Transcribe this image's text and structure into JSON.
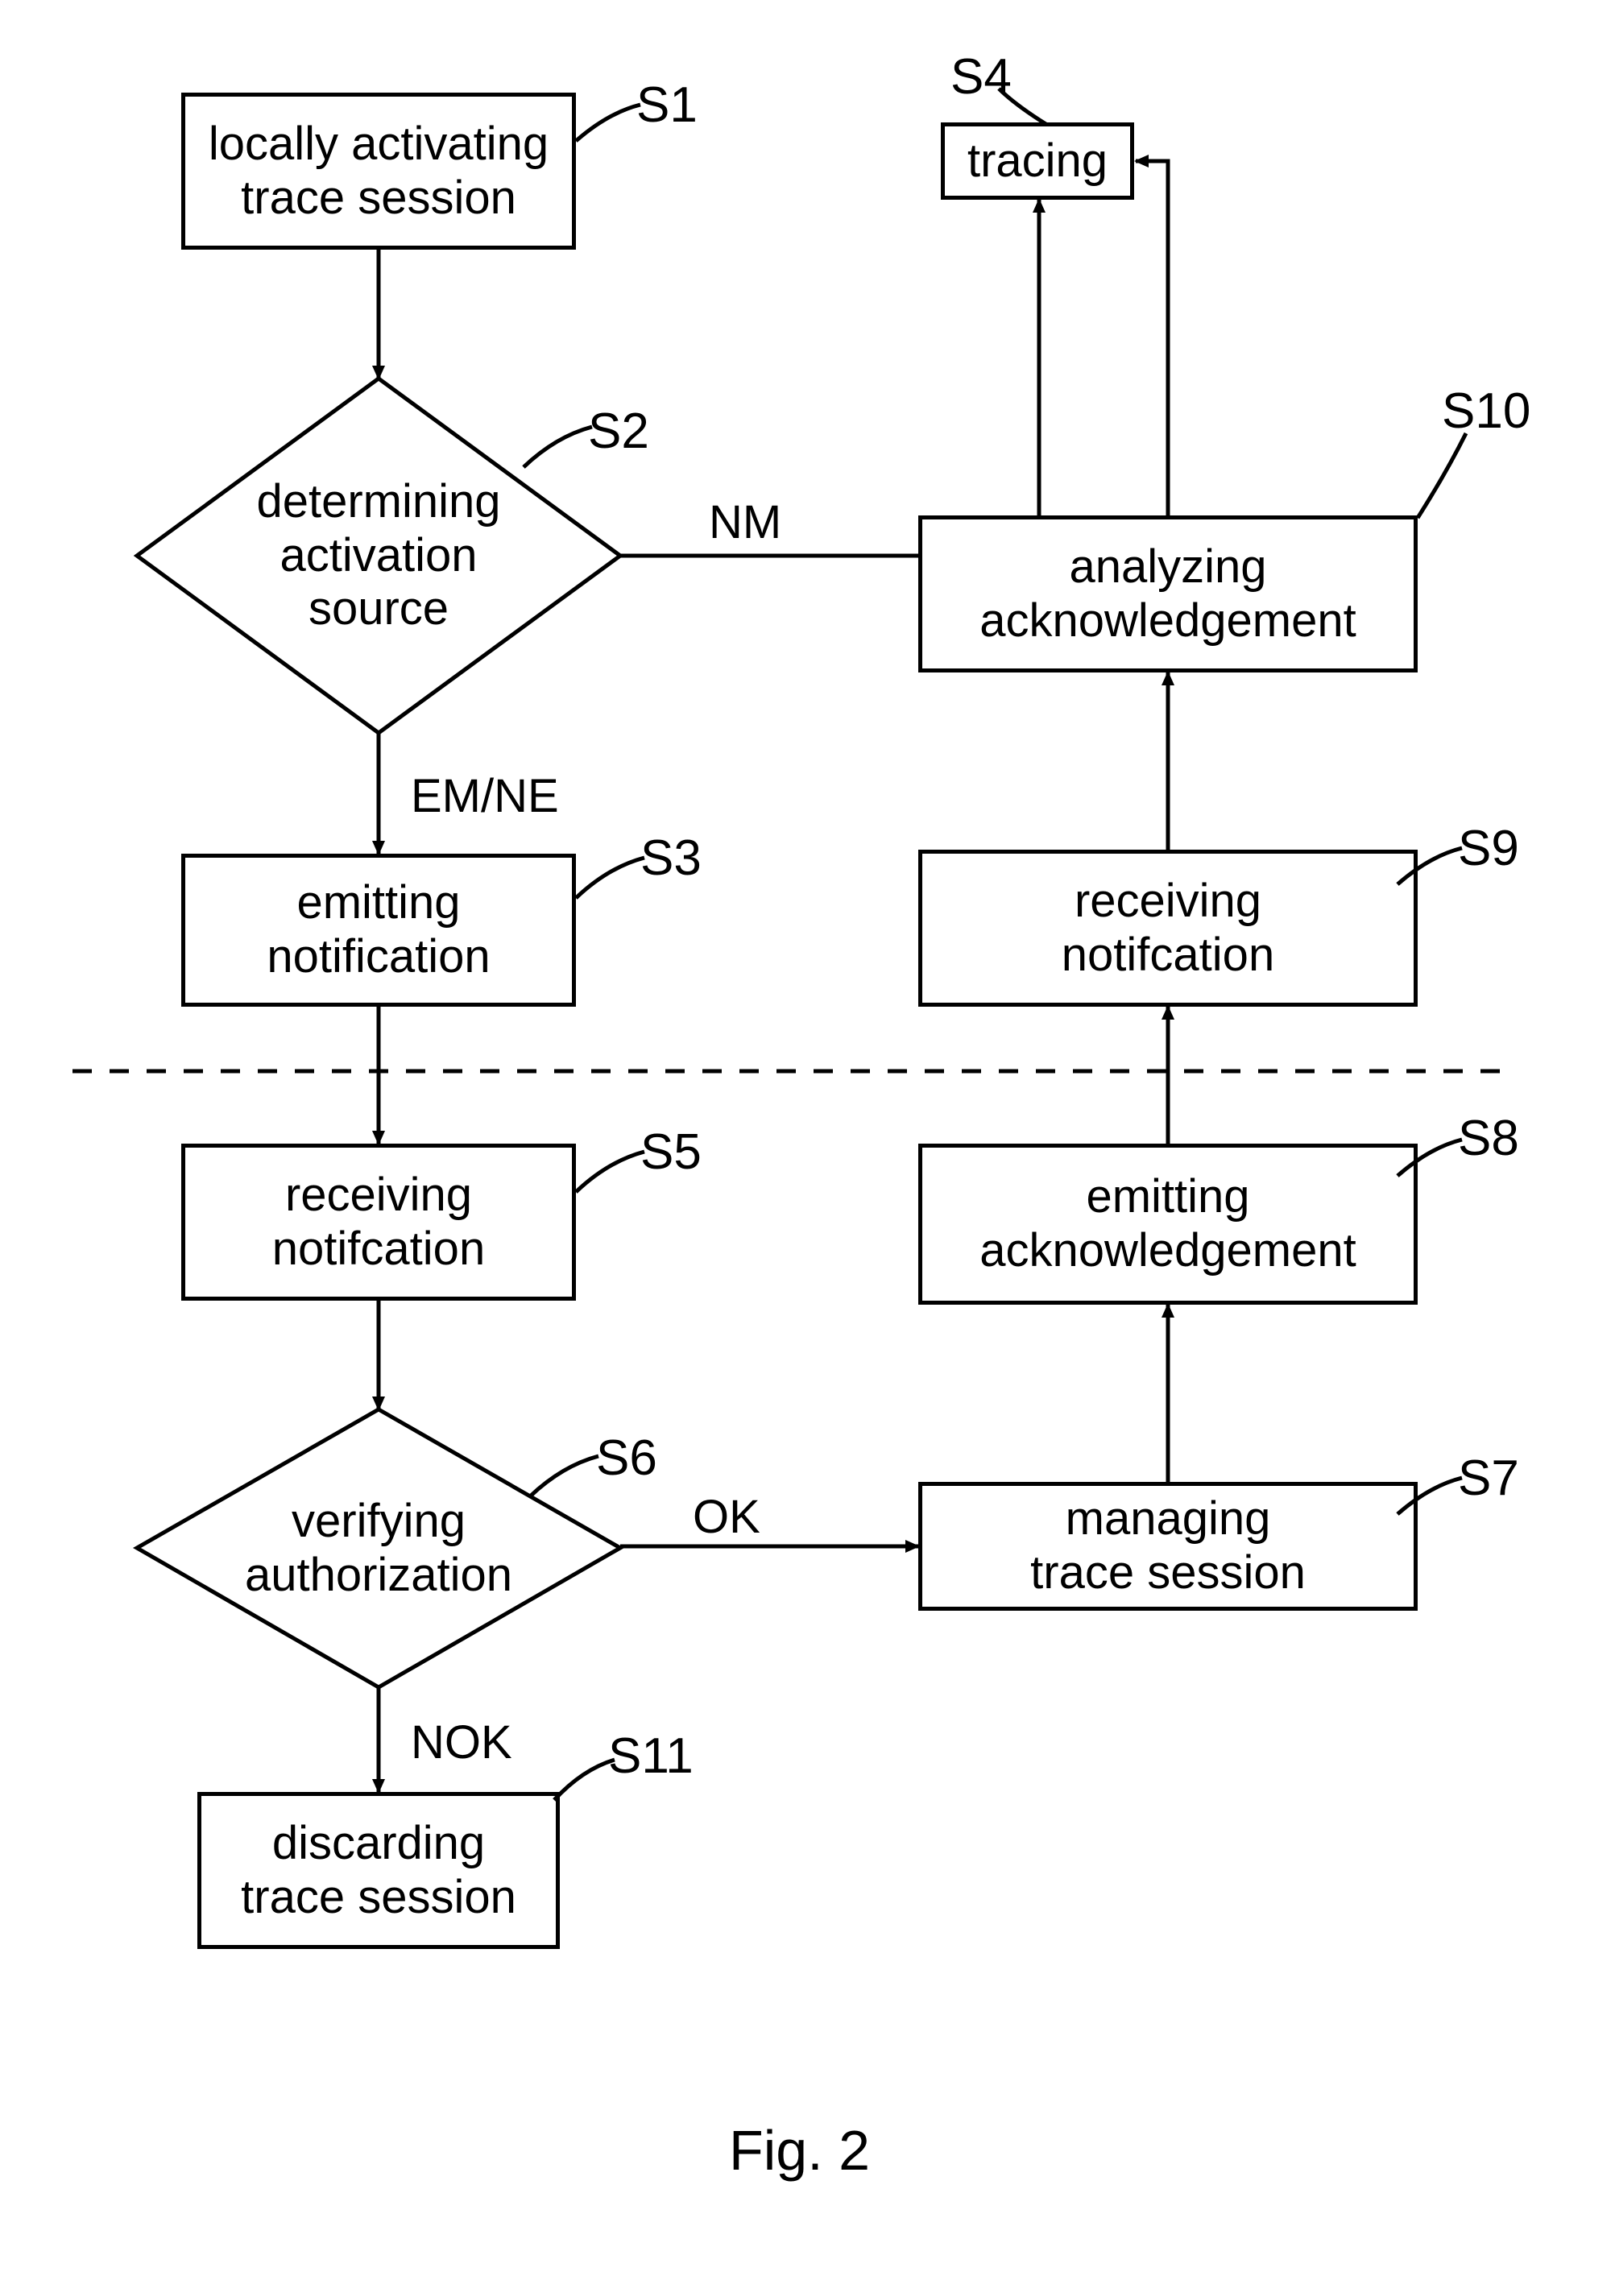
{
  "figure_caption": "Fig. 2",
  "nodes": {
    "s1": {
      "tag": "S1",
      "text": "locally activating\ntrace session"
    },
    "s2": {
      "tag": "S2",
      "text": "determining\nactivation\nsource"
    },
    "s3": {
      "tag": "S3",
      "text": "emitting\nnotification"
    },
    "s4": {
      "tag": "S4",
      "text": "tracing"
    },
    "s5": {
      "tag": "S5",
      "text": "receiving\nnotifcation"
    },
    "s6": {
      "tag": "S6",
      "text": "verifying\nauthorization"
    },
    "s7": {
      "tag": "S7",
      "text": "managing\ntrace session"
    },
    "s8": {
      "tag": "S8",
      "text": "emitting\nacknowledgement"
    },
    "s9": {
      "tag": "S9",
      "text": "receiving\nnotifcation"
    },
    "s10": {
      "tag": "S10",
      "text": "analyzing\nacknowledgement"
    },
    "s11": {
      "tag": "S11",
      "text": "discarding\ntrace session"
    }
  },
  "edges": {
    "s2_right": "NM",
    "s2_down": "EM/NE",
    "s6_right": "OK",
    "s6_down": "NOK"
  },
  "chart_data": {
    "type": "flowchart",
    "title": "Fig. 2",
    "partition": "horizontal dashed line separates upper section (S1–S4, S9, S10) from lower section (S5–S8, S11)",
    "nodes": [
      {
        "id": "S1",
        "shape": "process",
        "label": "locally activating trace session"
      },
      {
        "id": "S2",
        "shape": "decision",
        "label": "determining activation source"
      },
      {
        "id": "S3",
        "shape": "process",
        "label": "emitting notification"
      },
      {
        "id": "S4",
        "shape": "process",
        "label": "tracing"
      },
      {
        "id": "S5",
        "shape": "process",
        "label": "receiving notifcation"
      },
      {
        "id": "S6",
        "shape": "decision",
        "label": "verifying authorization"
      },
      {
        "id": "S7",
        "shape": "process",
        "label": "managing trace session"
      },
      {
        "id": "S8",
        "shape": "process",
        "label": "emitting acknowledgement"
      },
      {
        "id": "S9",
        "shape": "process",
        "label": "receiving notifcation"
      },
      {
        "id": "S10",
        "shape": "process",
        "label": "analyzing acknowledgement"
      },
      {
        "id": "S11",
        "shape": "process",
        "label": "discarding trace session"
      }
    ],
    "edges": [
      {
        "from": "S1",
        "to": "S2",
        "label": ""
      },
      {
        "from": "S2",
        "to": "S4",
        "label": "NM"
      },
      {
        "from": "S2",
        "to": "S3",
        "label": "EM/NE"
      },
      {
        "from": "S3",
        "to": "S5",
        "label": ""
      },
      {
        "from": "S5",
        "to": "S6",
        "label": ""
      },
      {
        "from": "S6",
        "to": "S7",
        "label": "OK"
      },
      {
        "from": "S6",
        "to": "S11",
        "label": "NOK"
      },
      {
        "from": "S7",
        "to": "S8",
        "label": ""
      },
      {
        "from": "S8",
        "to": "S9",
        "label": ""
      },
      {
        "from": "S9",
        "to": "S10",
        "label": ""
      },
      {
        "from": "S10",
        "to": "S4",
        "label": ""
      }
    ]
  }
}
